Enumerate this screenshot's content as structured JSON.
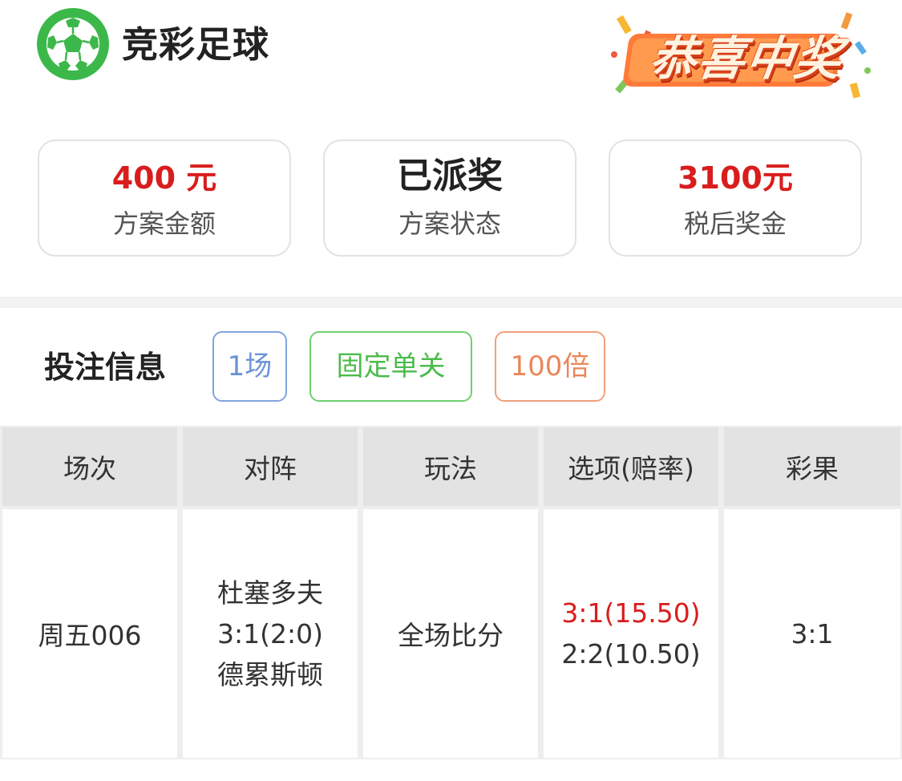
{
  "header": {
    "app_title": "竞彩足球",
    "banner_text": "恭喜中奖",
    "icon": "soccer-ball-icon"
  },
  "summary": {
    "amount": {
      "value": "400 元",
      "label": "方案金额"
    },
    "status": {
      "value": "已派奖",
      "label": "方案状态"
    },
    "prize": {
      "value": "3100元",
      "label": "税后奖金"
    }
  },
  "bet_info": {
    "title": "投注信息",
    "tags": {
      "matches": "1场",
      "type": "固定单关",
      "multiple": "100倍"
    }
  },
  "table": {
    "headers": [
      "场次",
      "对阵",
      "玩法",
      "选项(赔率)",
      "彩果"
    ],
    "rows": [
      {
        "match_no": "周五006",
        "home_team": "杜塞多夫",
        "score": "3:1(2:0)",
        "away_team": "德累斯顿",
        "play_type": "全场比分",
        "options": [
          "3:1(15.50)",
          "2:2(10.50)"
        ],
        "result": "3:1"
      }
    ]
  },
  "colors": {
    "accent_red": "#d91d1d",
    "logo_green": "#3cb84a",
    "tag_blue": "#6b93d6",
    "tag_green": "#4cbb4c",
    "tag_orange": "#ea8659"
  }
}
